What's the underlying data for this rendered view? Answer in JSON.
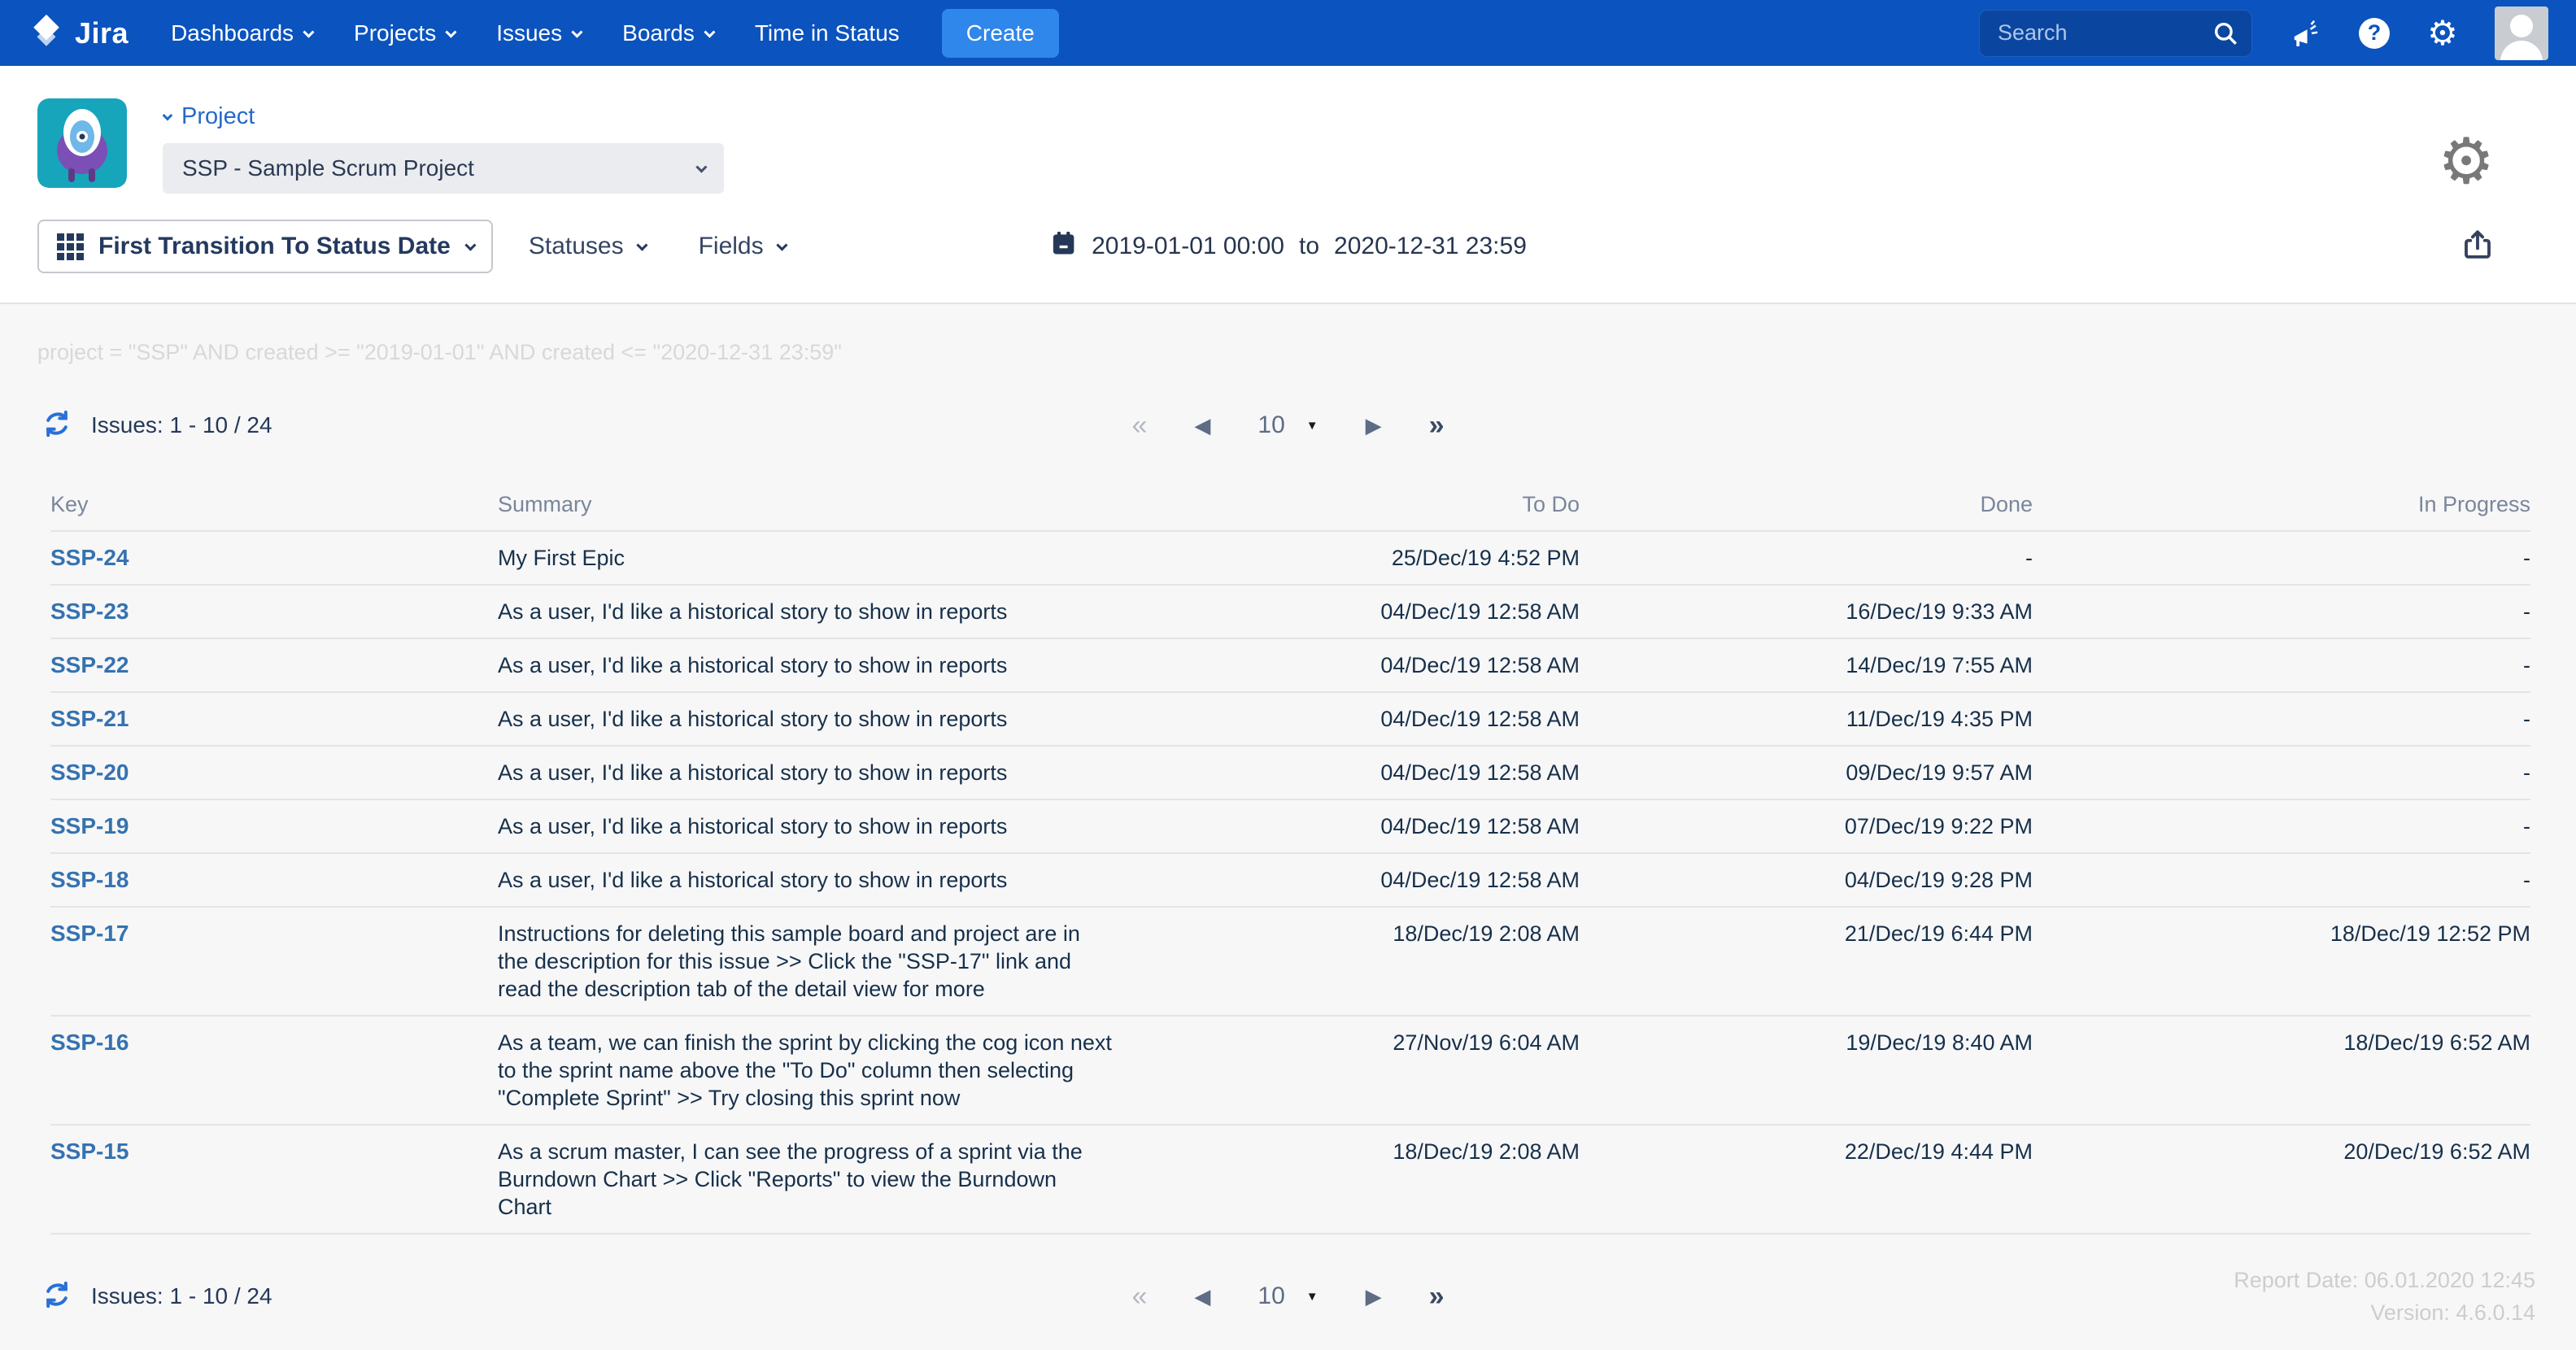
{
  "nav": {
    "brand": "Jira",
    "items": [
      {
        "label": "Dashboards",
        "dropdown": true
      },
      {
        "label": "Projects",
        "dropdown": true
      },
      {
        "label": "Issues",
        "dropdown": true
      },
      {
        "label": "Boards",
        "dropdown": true
      },
      {
        "label": "Time in Status",
        "dropdown": false
      }
    ],
    "create_label": "Create",
    "search_placeholder": "Search"
  },
  "header": {
    "section_label": "Project",
    "project_select_value": "SSP - Sample Scrum Project"
  },
  "filters": {
    "date_type_label": "First Transition To Status Date",
    "statuses_label": "Statuses",
    "fields_label": "Fields",
    "date_from": "2019-01-01 00:00",
    "date_separator": "to",
    "date_to": "2020-12-31 23:59"
  },
  "jql": "project = \"SSP\" AND created >= \"2019-01-01\" AND created <= \"2020-12-31 23:59\"",
  "issues_bar": {
    "count_label": "Issues: 1 - 10 / 24",
    "page_size": "10"
  },
  "table": {
    "columns": [
      "Key",
      "Summary",
      "To Do",
      "Done",
      "In Progress"
    ],
    "rows": [
      {
        "key": "SSP-24",
        "summary": "My First Epic",
        "todo": "25/Dec/19 4:52 PM",
        "done": "-",
        "in_progress": "-"
      },
      {
        "key": "SSP-23",
        "summary": "As a user, I'd like a historical story to show in reports",
        "todo": "04/Dec/19 12:58 AM",
        "done": "16/Dec/19 9:33 AM",
        "in_progress": "-"
      },
      {
        "key": "SSP-22",
        "summary": "As a user, I'd like a historical story to show in reports",
        "todo": "04/Dec/19 12:58 AM",
        "done": "14/Dec/19 7:55 AM",
        "in_progress": "-"
      },
      {
        "key": "SSP-21",
        "summary": "As a user, I'd like a historical story to show in reports",
        "todo": "04/Dec/19 12:58 AM",
        "done": "11/Dec/19 4:35 PM",
        "in_progress": "-"
      },
      {
        "key": "SSP-20",
        "summary": "As a user, I'd like a historical story to show in reports",
        "todo": "04/Dec/19 12:58 AM",
        "done": "09/Dec/19 9:57 AM",
        "in_progress": "-"
      },
      {
        "key": "SSP-19",
        "summary": "As a user, I'd like a historical story to show in reports",
        "todo": "04/Dec/19 12:58 AM",
        "done": "07/Dec/19 9:22 PM",
        "in_progress": "-"
      },
      {
        "key": "SSP-18",
        "summary": "As a user, I'd like a historical story to show in reports",
        "todo": "04/Dec/19 12:58 AM",
        "done": "04/Dec/19 9:28 PM",
        "in_progress": "-"
      },
      {
        "key": "SSP-17",
        "summary": "Instructions for deleting this sample board and project are in the description for this issue >> Click the \"SSP-17\" link and read the description tab of the detail view for more",
        "todo": "18/Dec/19 2:08 AM",
        "done": "21/Dec/19 6:44 PM",
        "in_progress": "18/Dec/19 12:52 PM"
      },
      {
        "key": "SSP-16",
        "summary": "As a team, we can finish the sprint by clicking the cog icon next to the sprint name above the \"To Do\" column then selecting \"Complete Sprint\" >> Try closing this sprint now",
        "todo": "27/Nov/19 6:04 AM",
        "done": "19/Dec/19 8:40 AM",
        "in_progress": "18/Dec/19 6:52 AM"
      },
      {
        "key": "SSP-15",
        "summary": "As a scrum master, I can see the progress of a sprint via the Burndown Chart >> Click \"Reports\" to view the Burndown Chart",
        "todo": "18/Dec/19 2:08 AM",
        "done": "22/Dec/19 4:44 PM",
        "in_progress": "20/Dec/19 6:52 AM"
      }
    ]
  },
  "pagination": {
    "first": "«",
    "prev": "◀",
    "next": "▶",
    "last": "»",
    "caret": "▼"
  },
  "footer": {
    "report_date": "Report Date: 06.01.2020 12:45",
    "version": "Version: 4.6.0.14"
  },
  "icons": {
    "search": "magnifier",
    "feedback": "megaphone",
    "help": "question-mark-circle",
    "settings": "gear",
    "report_settings": "gear",
    "export": "share-box-up-arrow",
    "refresh": "circular-arrows",
    "calendar": "calendar",
    "date_type": "grid-dots",
    "dropdown": "chevron-down",
    "help_glyph": "?"
  },
  "colors": {
    "nav_bg": "#0B53BE",
    "create_btn": "#2F86EB",
    "search_bg": "#0A46A0",
    "link_blue": "#3572B0",
    "navy_text": "#253858",
    "header_gray": "#7A869A",
    "content_bg": "#F7F7F8",
    "jql_gray": "#D8D8D8",
    "row_border": "#E4E4E6",
    "refresh_blue": "#2970D6",
    "project_avatar_teal": "#17A5BC",
    "project_avatar_purple": "#7B4FB5"
  }
}
